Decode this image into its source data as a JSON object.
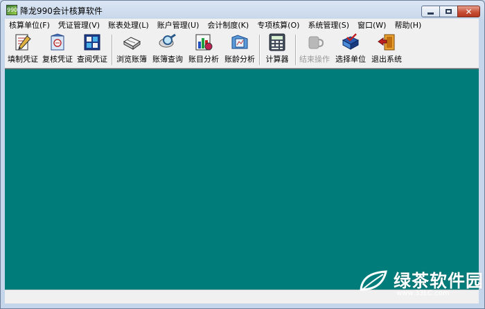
{
  "window": {
    "title": "降龙990会计核算软件"
  },
  "menu": [
    "核算单位(F)",
    "凭证管理(V)",
    "账表处理(L)",
    "账户管理(U)",
    "会计制度(K)",
    "专项核算(O)",
    "系统管理(S)",
    "窗口(W)",
    "帮助(H)"
  ],
  "toolbar": {
    "fill_voucher": "填制凭证",
    "review_voucher": "复核凭证",
    "query_voucher": "查阅凭证",
    "browse_ledger": "浏览账簿",
    "ledger_query": "账簿查询",
    "account_analysis": "账目分析",
    "aging_analysis": "账龄分析",
    "calculator": "计算器",
    "end_operation": "结束操作",
    "select_unit": "选择单位",
    "exit_system": "退出系统"
  },
  "watermark": {
    "text": "绿茶软件园",
    "url": "www.33LC.com"
  },
  "colors": {
    "client_bg": "#007d7b",
    "accent_red": "#c54b32"
  }
}
